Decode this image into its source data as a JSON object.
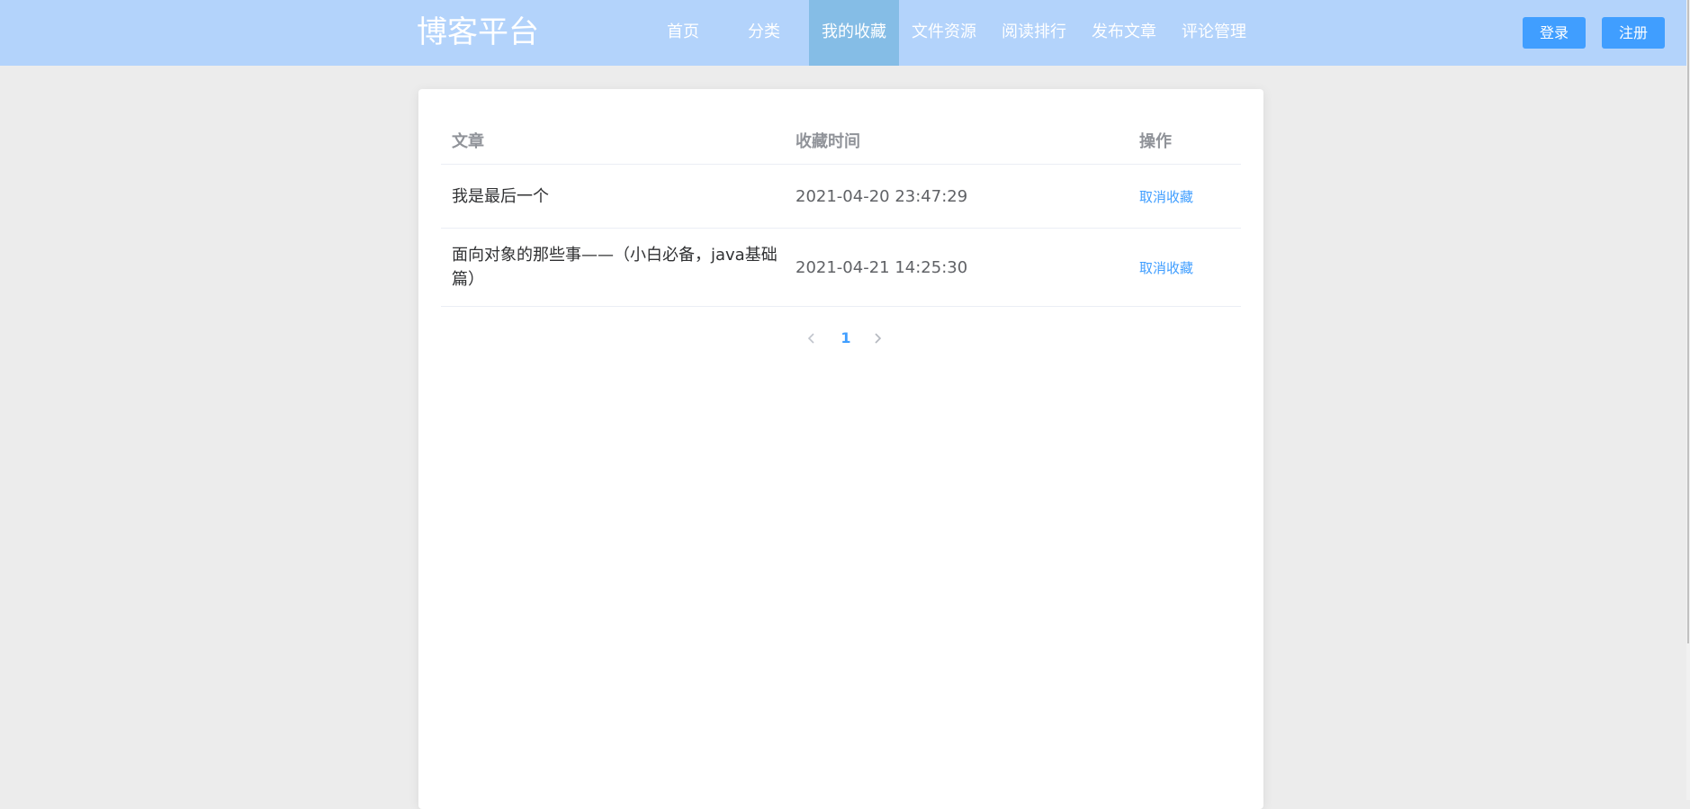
{
  "header": {
    "brand": "博客平台",
    "nav": [
      {
        "label": "首页",
        "active": false
      },
      {
        "label": "分类",
        "active": false
      },
      {
        "label": "我的收藏",
        "active": true
      },
      {
        "label": "文件资源",
        "active": false
      },
      {
        "label": "阅读排行",
        "active": false
      },
      {
        "label": "发布文章",
        "active": false
      },
      {
        "label": "评论管理",
        "active": false
      }
    ],
    "login_label": "登录",
    "register_label": "注册"
  },
  "table": {
    "columns": [
      "文章",
      "收藏时间",
      "操作"
    ],
    "rows": [
      {
        "title": "我是最后一个",
        "time": "2021-04-20 23:47:29",
        "action": "取消收藏"
      },
      {
        "title": "面向对象的那些事——（小白必备，java基础篇）",
        "time": "2021-04-21 14:25:30",
        "action": "取消收藏"
      }
    ]
  },
  "pagination": {
    "prev_icon": "chevron-left-icon",
    "current_page": "1",
    "next_icon": "chevron-right-icon"
  },
  "colors": {
    "header_bg": "#b3d3fb",
    "nav_active_bg": "#85bde6",
    "primary": "#409eff",
    "page_bg": "#ececec"
  }
}
